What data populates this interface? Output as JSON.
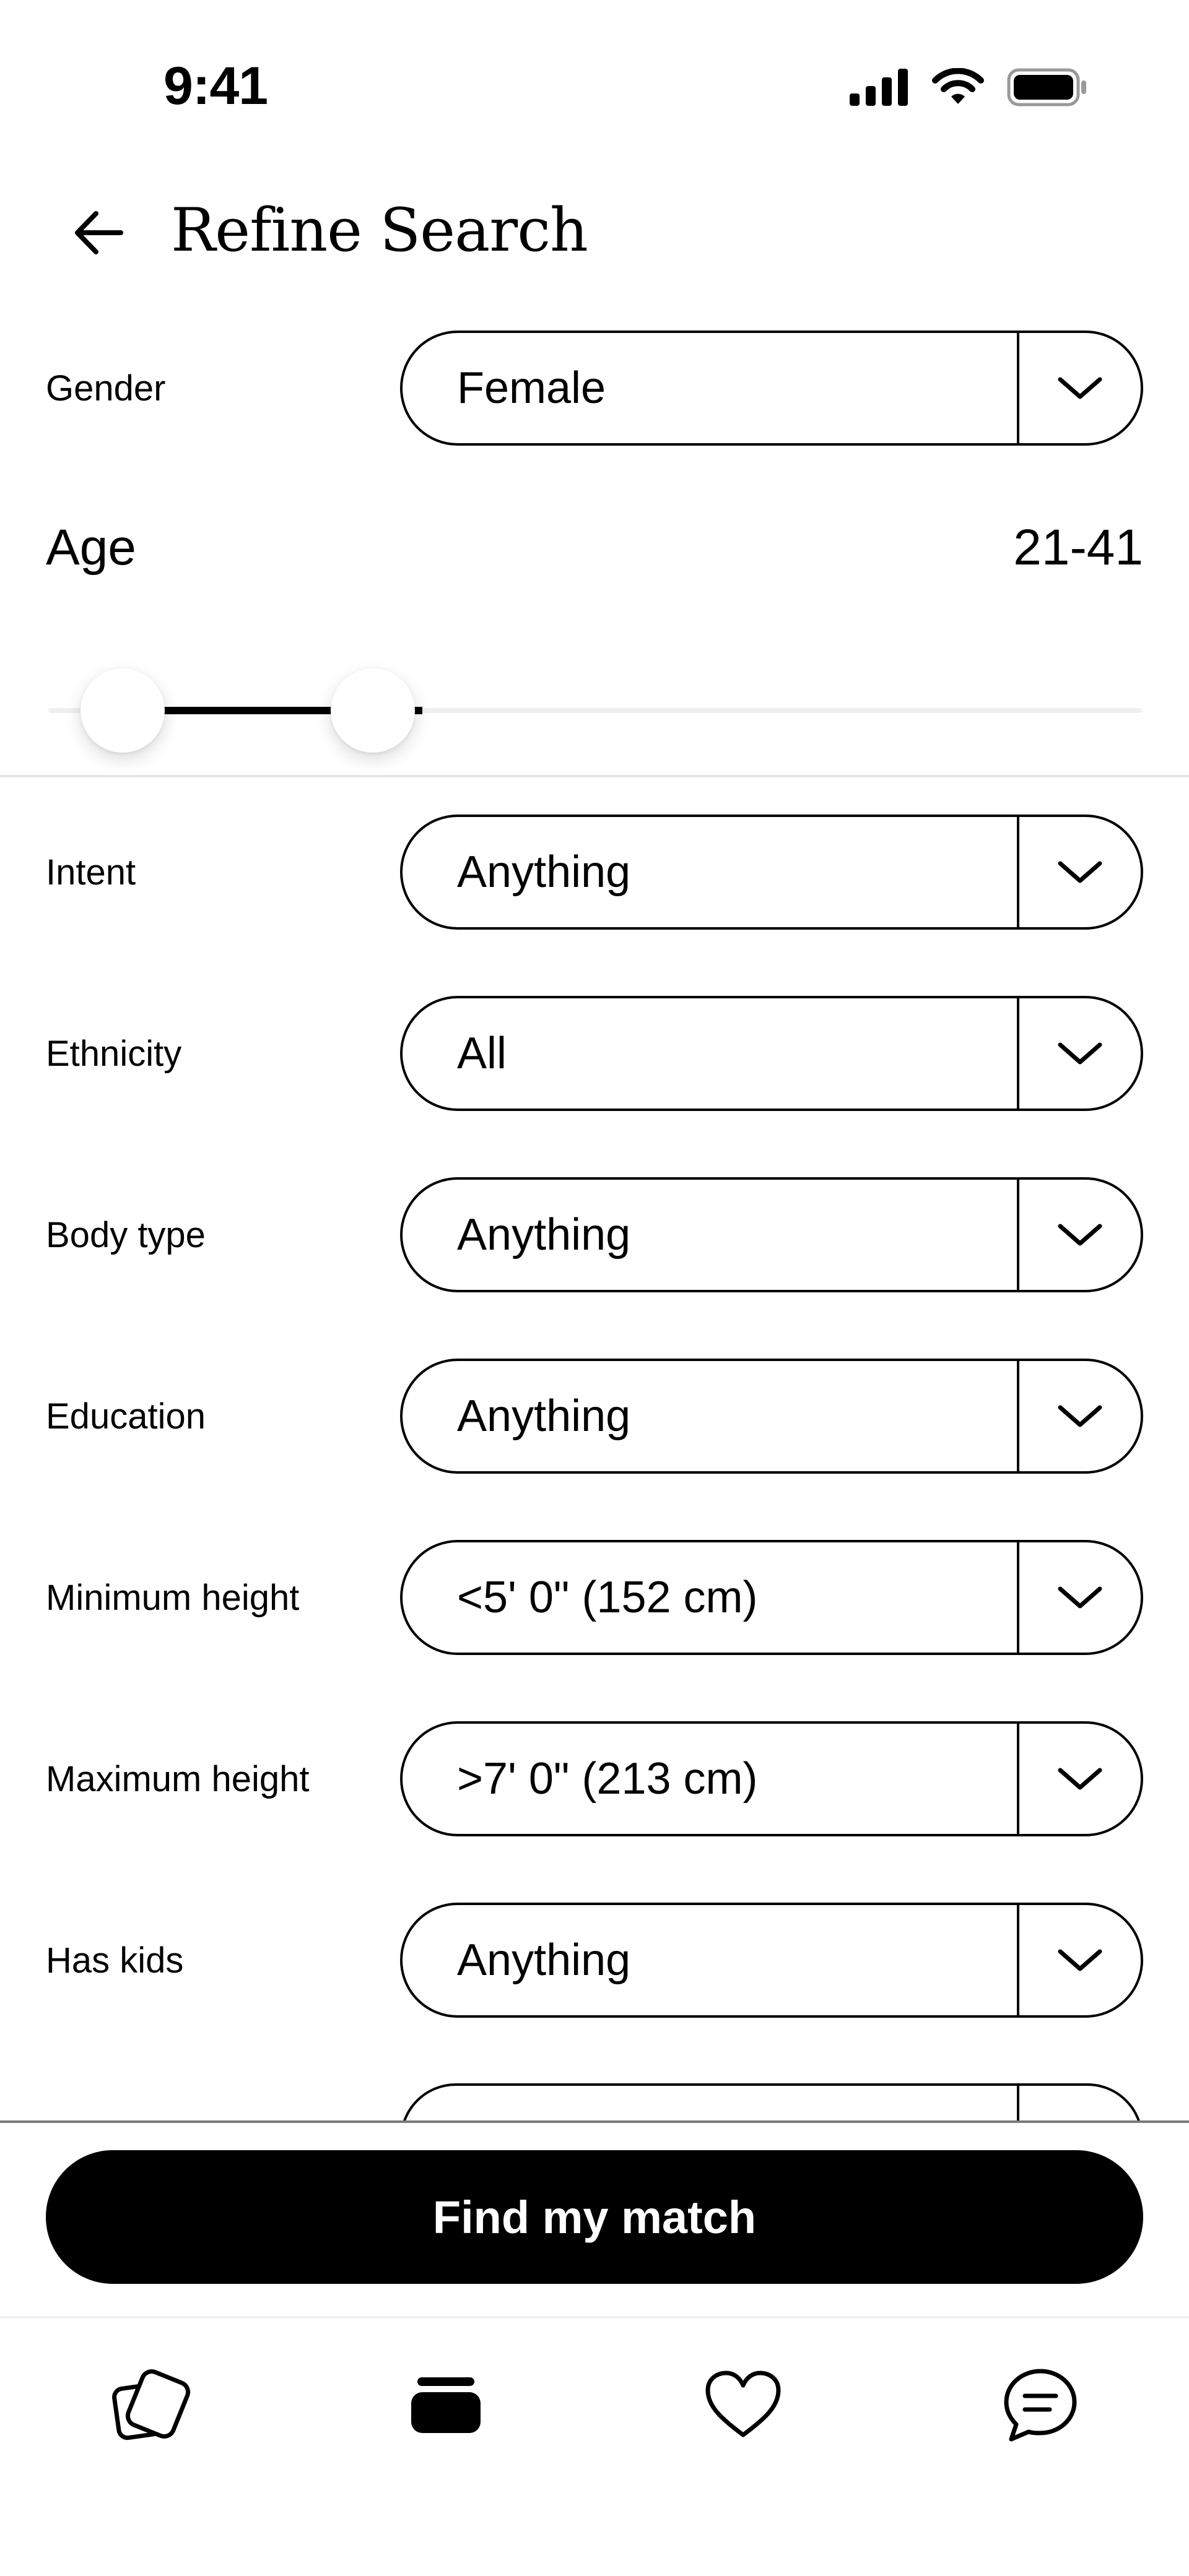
{
  "status_bar": {
    "time": "9:41",
    "icons": [
      "signal-icon",
      "wifi-icon",
      "battery-icon"
    ]
  },
  "header": {
    "title": "Refine Search",
    "back_icon": "arrow-left-icon"
  },
  "gender": {
    "label": "Gender",
    "value": "Female"
  },
  "age": {
    "label": "Age",
    "value": "21-41",
    "min_value": 21,
    "max_value": 41
  },
  "filters": [
    {
      "label": "Intent",
      "value": "Anything"
    },
    {
      "label": "Ethnicity",
      "value": "All"
    },
    {
      "label": "Body type",
      "value": "Anything"
    },
    {
      "label": "Education",
      "value": "Anything"
    },
    {
      "label": "Minimum height",
      "value": "<5' 0\" (152 cm)"
    },
    {
      "label": "Maximum height",
      "value": ">7' 0\" (213 cm)"
    },
    {
      "label": "Has kids",
      "value": "Anything"
    }
  ],
  "cta": {
    "label": "Find my match"
  },
  "tabbar": {
    "tabs": [
      {
        "icon": "cards-icon"
      },
      {
        "icon": "stack-icon",
        "active": true
      },
      {
        "icon": "heart-icon"
      },
      {
        "icon": "chat-bubble-icon"
      }
    ]
  },
  "colors": {
    "primary": "#000000",
    "background": "#ffffff",
    "divider": "#e6e6e6",
    "track": "#efefef"
  }
}
